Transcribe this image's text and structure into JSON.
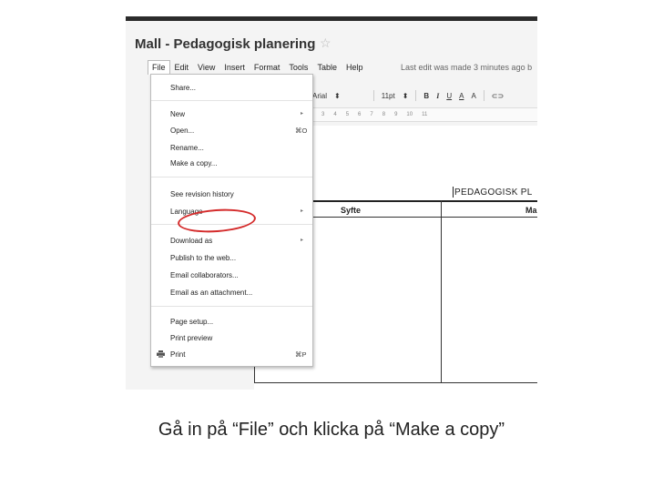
{
  "document": {
    "title": "Mall - Pedagogisk planering",
    "star_glyph": "☆",
    "last_edit": "Last edit was made 3 minutes ago b"
  },
  "menubar": {
    "items": [
      "File",
      "Edit",
      "View",
      "Insert",
      "Format",
      "Tools",
      "Table",
      "Help"
    ]
  },
  "toolbar": {
    "font": "Arial",
    "font_arrow": "⬍",
    "size": "11pt",
    "size_arrow": "⬍",
    "bold": "B",
    "italic": "I",
    "underline": "U",
    "text_color": "A",
    "highlight": "A",
    "more": "⊂⊃"
  },
  "ruler": {
    "marks": [
      "3",
      "4",
      "5",
      "6",
      "7",
      "8",
      "9",
      "10",
      "11"
    ]
  },
  "page": {
    "heading": "PEDAGOGISK PL",
    "columns": [
      "Syfte",
      "Ma"
    ]
  },
  "file_menu": {
    "items": {
      "share": "Share...",
      "new": "New",
      "open": "Open...",
      "open_shortcut": "⌘O",
      "rename": "Rename...",
      "make_copy": "Make a copy...",
      "revision_history": "See revision history",
      "language": "Language",
      "download_as": "Download as",
      "publish": "Publish to the web...",
      "email_collaborators": "Email collaborators...",
      "email_attachment": "Email as an attachment...",
      "page_setup": "Page setup...",
      "print_preview": "Print preview",
      "print": "Print",
      "print_shortcut": "⌘P"
    },
    "submenu_arrow": "▸"
  },
  "annotation": {
    "highlight_color": "#d42a2a"
  },
  "caption": "Gå in på “File” och klicka på “Make a copy”"
}
